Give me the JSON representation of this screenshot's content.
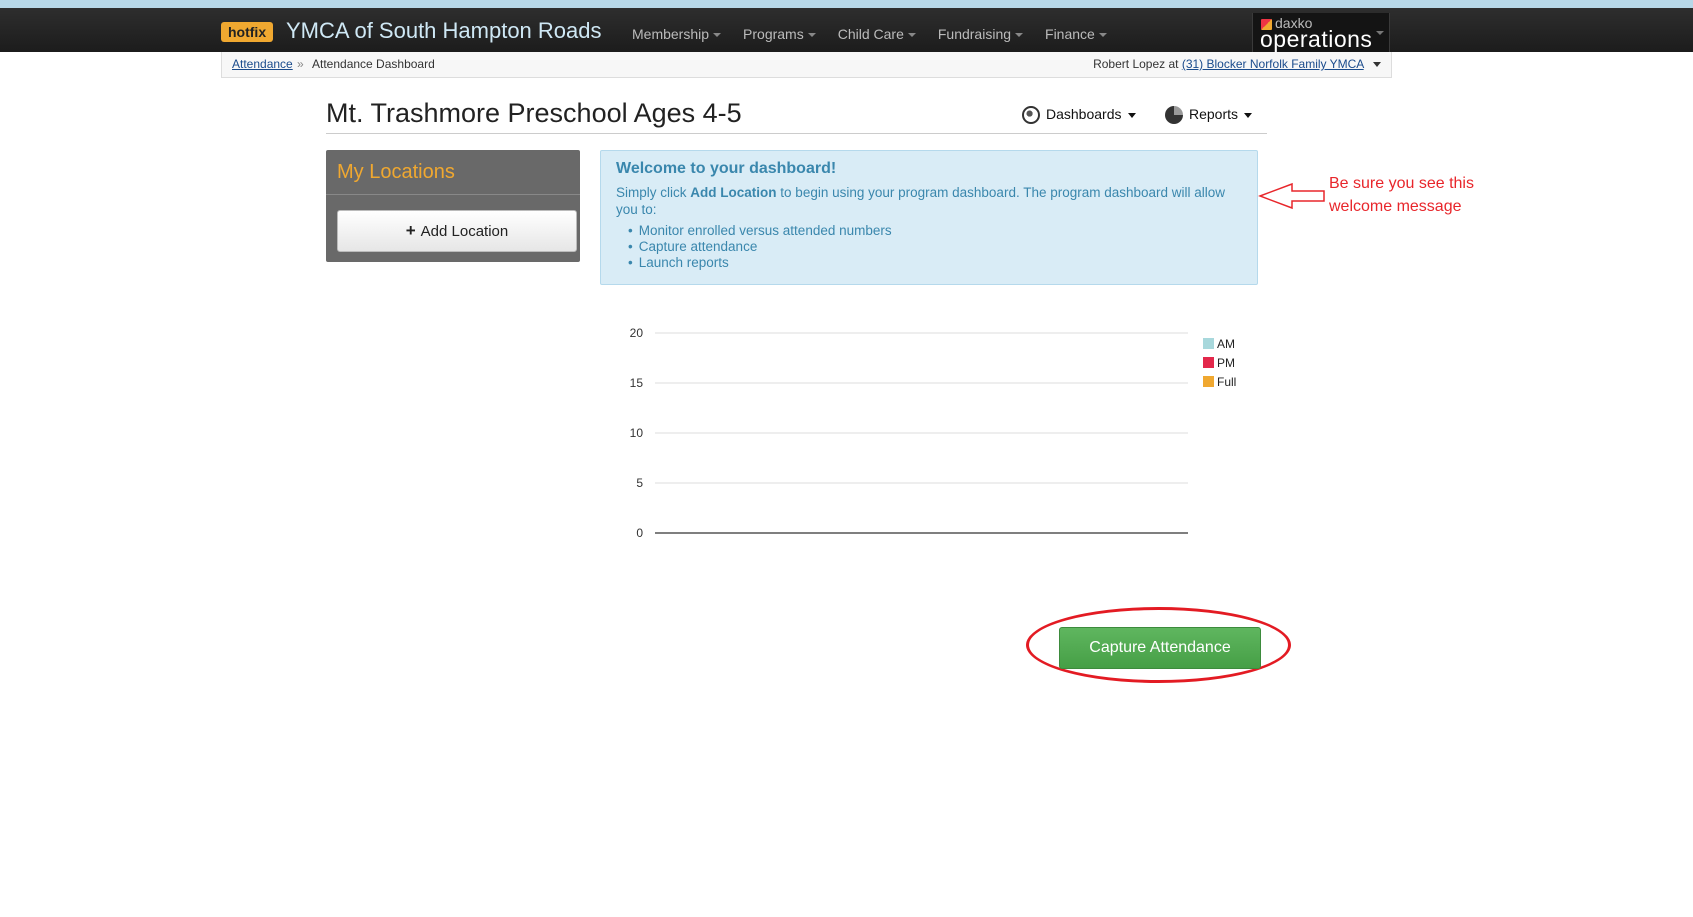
{
  "header": {
    "badge": "hotfix",
    "org_title": "YMCA of South Hampton Roads",
    "nav": [
      "Membership",
      "Programs",
      "Child Care",
      "Fundraising",
      "Finance"
    ],
    "brand_small": "daxko",
    "brand_big": "operations"
  },
  "breadcrumb": {
    "link": "Attendance",
    "separator": "»",
    "current": "Attendance Dashboard"
  },
  "user": {
    "name_prefix": "Robert Lopez at",
    "location": "(31) Blocker Norfolk Family YMCA"
  },
  "page": {
    "title": "Mt. Trashmore Preschool Ages 4-5",
    "dashboards_label": "Dashboards",
    "reports_label": "Reports"
  },
  "locations": {
    "title": "My Locations",
    "add_label": "Add Location"
  },
  "welcome": {
    "title": "Welcome to your dashboard!",
    "body_before": "Simply click",
    "body_bold": "Add Location",
    "body_after": "to begin using your program dashboard. The program dashboard will allow you to:",
    "items": [
      "Monitor enrolled versus attended numbers",
      "Capture attendance",
      "Launch reports"
    ]
  },
  "annotation": {
    "text": "Be sure you see this welcome message",
    "color": "#e8262b"
  },
  "chart_data": {
    "type": "bar",
    "categories": [],
    "series": [
      {
        "name": "AM",
        "color": "#a8d8dc",
        "values": []
      },
      {
        "name": "PM",
        "color": "#e3284b",
        "values": []
      },
      {
        "name": "Full",
        "color": "#f0a830",
        "values": []
      }
    ],
    "yticks": [
      "20",
      "15",
      "10",
      "5",
      "0"
    ],
    "ylim": [
      0,
      20
    ],
    "grid": true,
    "legend": "right"
  },
  "actions": {
    "capture_label": "Capture Attendance"
  }
}
